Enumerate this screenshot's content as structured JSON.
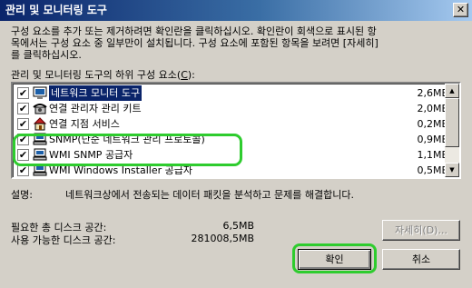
{
  "window": {
    "title": "관리 및 모니터링 도구",
    "close_glyph": "✕"
  },
  "description": "구성 요소를 추가 또는 제거하려면 확인란을 클릭하십시오. 확인란이 회색으로 표시된 항\n목에서는 구성 요소 중 일부만이 설치됩니다. 구성 요소에 포함된 항목을 보려면 [자세히]\n를 클릭하십시오.",
  "list": {
    "label_prefix": "관리 및 모니터링 도구의 하위 구성 요소(",
    "label_key": "C",
    "label_suffix": "):",
    "items": [
      {
        "name": "네트워크 모니터 도구",
        "size": "2,6MB",
        "checked": true,
        "icon": "monitor-icon",
        "selected": true
      },
      {
        "name": "연결 관리자 관리 키트",
        "size": "2,0MB",
        "checked": true,
        "icon": "phone-icon",
        "selected": false
      },
      {
        "name": "연결 지점 서비스",
        "size": "0,2MB",
        "checked": true,
        "icon": "house-icon",
        "selected": false
      },
      {
        "name": "SNMP(단순 네트워크 관리 프로토콜)",
        "size": "0,9MB",
        "checked": true,
        "icon": "network-computer-icon",
        "selected": false
      },
      {
        "name": "WMI SNMP 공급자",
        "size": "1,1MB",
        "checked": true,
        "icon": "network-computer-icon",
        "selected": false
      },
      {
        "name": "WMI Windows Installer 공급자",
        "size": "0,5MB",
        "checked": true,
        "icon": "network-computer-icon",
        "selected": false
      }
    ],
    "check_glyph": "✔",
    "scroll_up_glyph": "▲",
    "scroll_down_glyph": "▼"
  },
  "detail": {
    "label": "설명:",
    "text": "네트워크상에서 전송되는 데이터 패킷을 분석하고 문제를 해결합니다."
  },
  "disk": {
    "required_label": "필요한 총 디스크 공간:",
    "required_value": "6,5MB",
    "available_label": "사용 가능한 디스크 공간:",
    "available_value": "281008,5MB"
  },
  "buttons": {
    "details": "자세히(D)...",
    "ok": "확인",
    "cancel": "취소"
  },
  "colors": {
    "highlight": "#2ecc2e",
    "selection": "#0a246a"
  }
}
